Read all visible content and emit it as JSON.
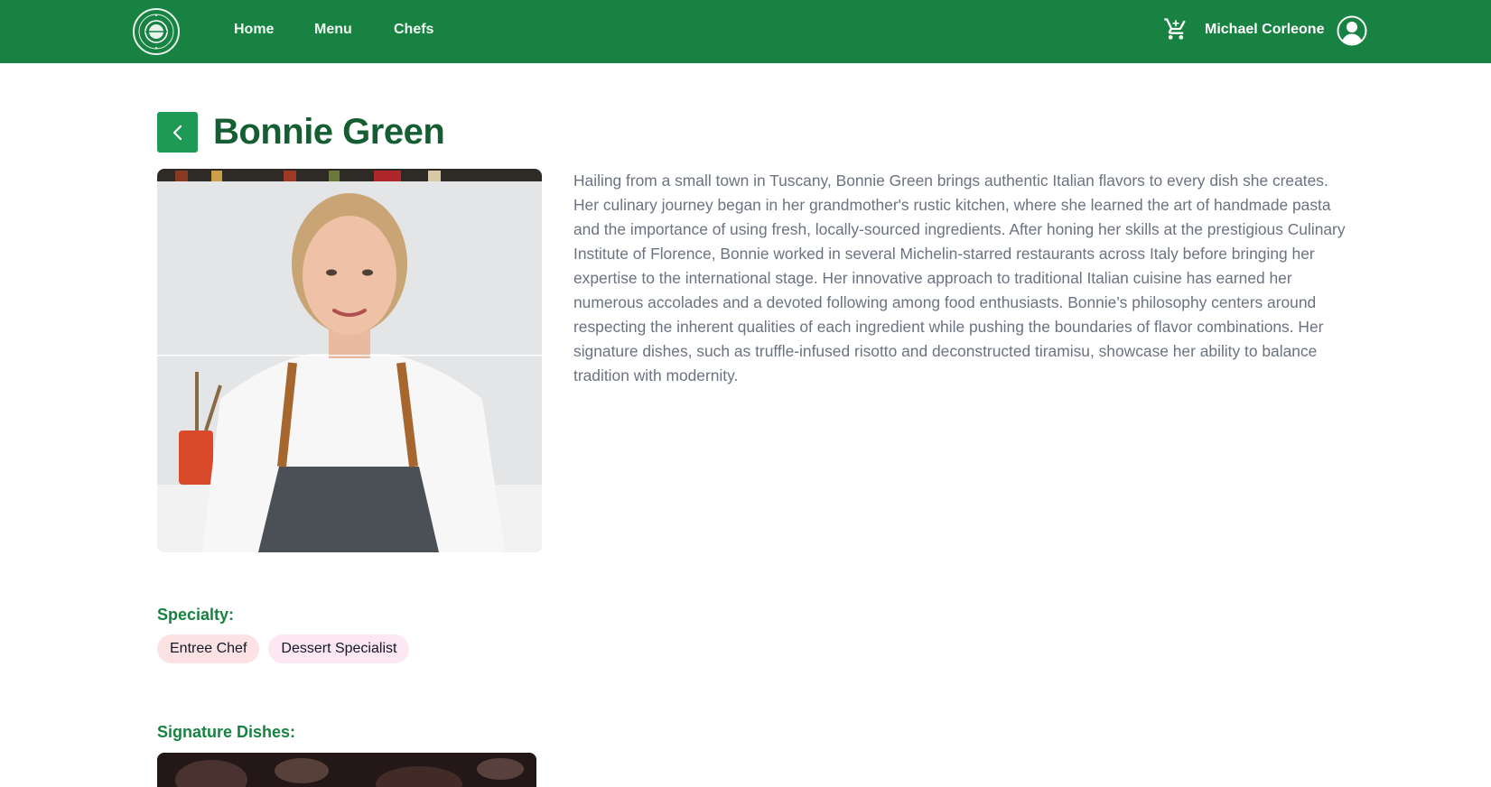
{
  "nav": {
    "links": [
      "Home",
      "Menu",
      "Chefs"
    ],
    "user_name": "Michael Corleone",
    "logo_icon": "restaurant-plate-logo",
    "cart_icon": "cart-icon",
    "avatar_icon": "user-circle-icon"
  },
  "chef": {
    "name": "Bonnie Green",
    "back_icon": "chevron-left-icon",
    "bio": "Hailing from a small town in Tuscany, Bonnie Green brings authentic Italian flavors to every dish she creates. Her culinary journey began in her grandmother's rustic kitchen, where she learned the art of handmade pasta and the importance of using fresh, locally-sourced ingredients. After honing her skills at the prestigious Culinary Institute of Florence, Bonnie worked in several Michelin-starred restaurants across Italy before bringing her expertise to the international stage. Her innovative approach to traditional Italian cuisine has earned her numerous accolades and a devoted following among food enthusiasts. Bonnie's philosophy centers around respecting the inherent qualities of each ingredient while pushing the boundaries of flavor combinations. Her signature dishes, such as truffle-infused risotto and deconstructed tiramisu, showcase her ability to balance tradition with modernity."
  },
  "specialty": {
    "label": "Specialty:",
    "tags": [
      "Entree Chef",
      "Dessert Specialist"
    ]
  },
  "signature": {
    "label": "Signature Dishes:"
  },
  "colors": {
    "brand_green": "#178241",
    "title_green": "#155e33",
    "back_button": "#1f9a55",
    "tag_pink_1": "#fde2e4",
    "tag_pink_2": "#fce7f3"
  }
}
